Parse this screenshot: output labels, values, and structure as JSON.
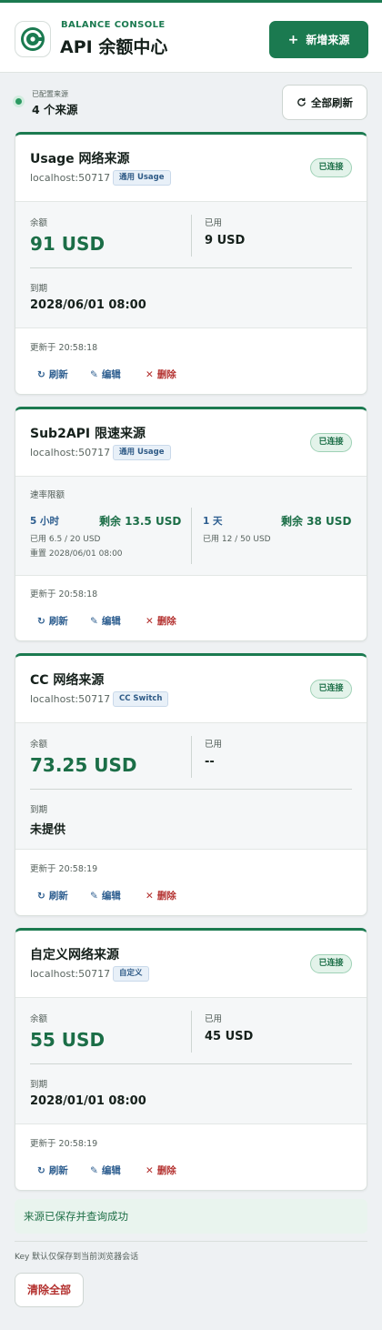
{
  "app": {
    "eyebrow": "BALANCE CONSOLE",
    "title": "API 余额中心",
    "add_button": "新增来源",
    "accent": "#1b7a50"
  },
  "summary": {
    "label": "已配置来源",
    "count": "4 个来源",
    "refresh_all": "全部刷新"
  },
  "actions": {
    "refresh": "刷新",
    "edit": "编辑",
    "delete": "删除"
  },
  "labels": {
    "balance": "余额",
    "used": "已用",
    "expiry": "到期",
    "rate_limit": "速率限额"
  },
  "cards": [
    {
      "title": "Usage 网络来源",
      "host": "localhost:50717",
      "tag": "通用 Usage",
      "status": "已连接",
      "balance": "91 USD",
      "used": "9 USD",
      "expiry": "2028/06/01 08:00",
      "updated": "更新于 20:58:18"
    },
    {
      "title": "Sub2API 限速来源",
      "host": "localhost:50717",
      "tag": "通用 Usage",
      "status": "已连接",
      "windows": [
        {
          "name": "5 小时",
          "remaining": "剩余 13.5 USD",
          "used": "已用 6.5 / 20 USD",
          "reset": "重置 2028/06/01 08:00"
        },
        {
          "name": "1 天",
          "remaining": "剩余 38 USD",
          "used": "已用 12 / 50 USD"
        }
      ],
      "updated": "更新于 20:58:18"
    },
    {
      "title": "CC 网络来源",
      "host": "localhost:50717",
      "tag": "CC Switch",
      "status": "已连接",
      "balance": "73.25 USD",
      "used": "--",
      "expiry": "未提供",
      "updated": "更新于 20:58:19"
    },
    {
      "title": "自定义网络来源",
      "host": "localhost:50717",
      "tag": "自定义",
      "status": "已连接",
      "balance": "55 USD",
      "used": "45 USD",
      "expiry": "2028/01/01 08:00",
      "updated": "更新于 20:58:19"
    }
  ],
  "success_message": "来源已保存并查询成功",
  "footer_note": "Key 默认仅保存到当前浏览器会话",
  "clear_all": "清除全部"
}
